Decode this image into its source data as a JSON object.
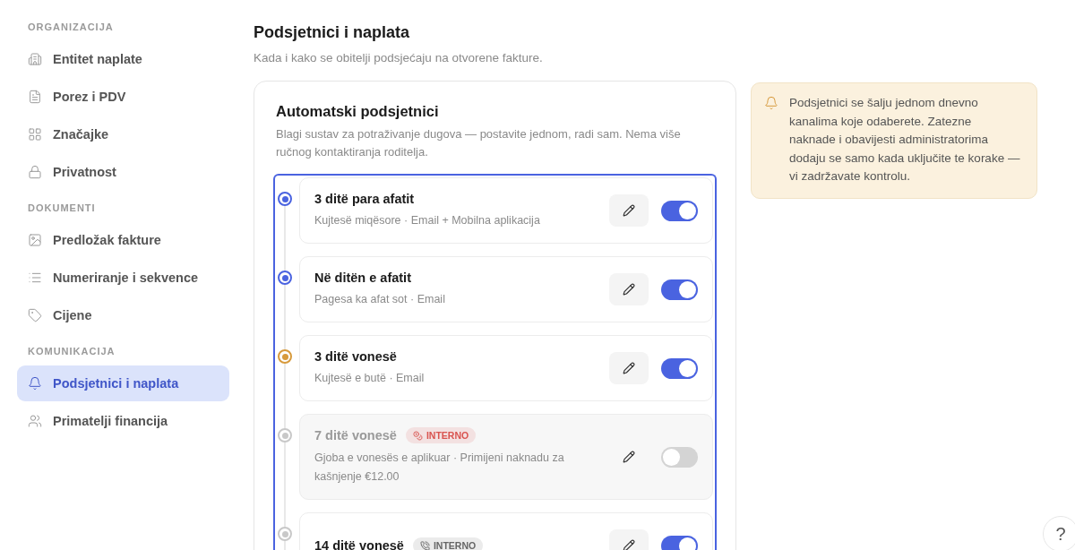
{
  "sidebar": {
    "sections": [
      {
        "heading": "ORGANIZACIJA",
        "items": [
          {
            "label": "Entitet naplate",
            "kind": "building",
            "selected": false
          },
          {
            "label": "Porez i PDV",
            "kind": "file",
            "selected": false
          },
          {
            "label": "Značajke",
            "kind": "grid",
            "selected": false
          },
          {
            "label": "Privatnost",
            "kind": "lock",
            "selected": false
          }
        ]
      },
      {
        "heading": "DOKUMENTI",
        "items": [
          {
            "label": "Predložak fakture",
            "kind": "image",
            "selected": false
          },
          {
            "label": "Numeriranje i sekvence",
            "kind": "list",
            "selected": false
          },
          {
            "label": "Cijene",
            "kind": "tag",
            "selected": false
          }
        ]
      },
      {
        "heading": "KOMUNIKACIJA",
        "items": [
          {
            "label": "Podsjetnici i naplata",
            "kind": "bell",
            "selected": true
          },
          {
            "label": "Primatelji financija",
            "kind": "users",
            "selected": false
          }
        ]
      }
    ]
  },
  "page": {
    "title": "Podsjetnici i naplata",
    "subtitle": "Kada i kako se obitelji podsjećaju na otvorene fakture."
  },
  "card": {
    "title": "Automatski podsjetnici",
    "description": "Blagi sustav za potraživanje dugova — postavite jednom, radi sam. Nema više ručnog kontaktiranja roditelja.",
    "steps": [
      {
        "title": "3 ditë para afatit",
        "detail": "Kujtesë miqësore · Email + Mobilna aplikacija",
        "color": "#4a63e0",
        "on": true
      },
      {
        "title": "Në ditën e afatit",
        "detail": "Pagesa ka afat sot · Email",
        "color": "#4a63e0",
        "on": true
      },
      {
        "title": "3 ditë vonesë",
        "detail": "Kujtesë e butë · Email",
        "color": "#d79a3c",
        "on": true
      },
      {
        "title": "7 ditë vonesë",
        "badge": {
          "label": "INTERNO",
          "kind": "fee",
          "color": "#d9534f"
        },
        "detail": "Gjoba e vonesës e aplikuar · Primijeni naknadu za kašnjenje €12.00",
        "color": "#c8c8c8",
        "on": false
      },
      {
        "title": "14 ditë vonesë",
        "badge": {
          "label": "INTERNO",
          "kind": "call",
          "color": "#666666"
        },
        "color": "#c8c8c8",
        "on": true
      }
    ]
  },
  "notice": {
    "text": "Podsjetnici se šalju jednom dnevno kanalima koje odaberete. Zatezne naknade i obavijesti administratorima dodaju se samo kada uključite te korake — vi zadržavate kontrolu."
  },
  "help": {
    "label": "?"
  }
}
